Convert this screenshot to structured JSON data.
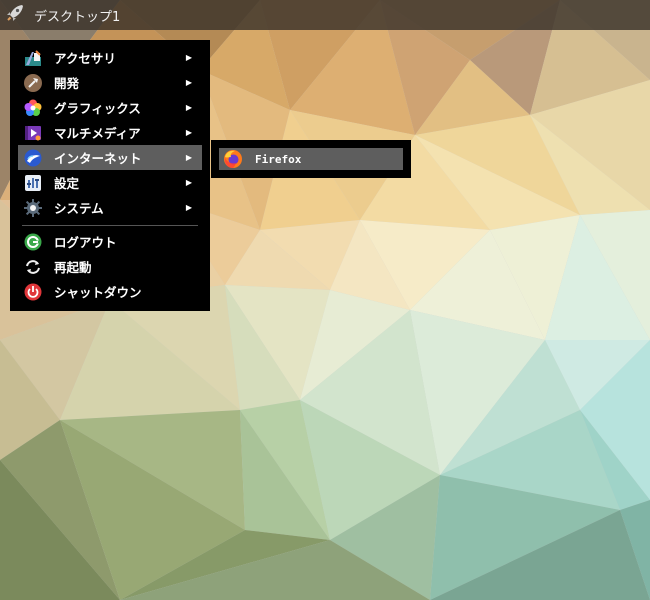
{
  "taskbar": {
    "title": "デスクトップ1",
    "launcher_icon": "rocket-icon"
  },
  "menu": {
    "items": [
      {
        "label": "アクセサリ",
        "icon": "accessories-icon",
        "arrow": "▶"
      },
      {
        "label": "開発",
        "icon": "development-icon",
        "arrow": "▶"
      },
      {
        "label": "グラフィックス",
        "icon": "graphics-icon",
        "arrow": "▶"
      },
      {
        "label": "マルチメディア",
        "icon": "multimedia-icon",
        "arrow": "▶"
      },
      {
        "label": "インターネット",
        "icon": "internet-icon",
        "arrow": "▶",
        "active": true
      },
      {
        "label": "設定",
        "icon": "settings-icon",
        "arrow": "▶"
      },
      {
        "label": "システム",
        "icon": "system-gear-icon",
        "arrow": "▶"
      }
    ],
    "actions": [
      {
        "label": "ログアウト",
        "icon": "logout-icon"
      },
      {
        "label": "再起動",
        "icon": "restart-icon"
      },
      {
        "label": "シャットダウン",
        "icon": "shutdown-icon"
      }
    ]
  },
  "submenu": {
    "items": [
      {
        "label": "Firefox",
        "icon": "firefox-icon"
      }
    ]
  },
  "colors": {
    "menu_bg": "#000000",
    "highlight": "#5e5e5e",
    "taskbar": "#3a332b"
  }
}
